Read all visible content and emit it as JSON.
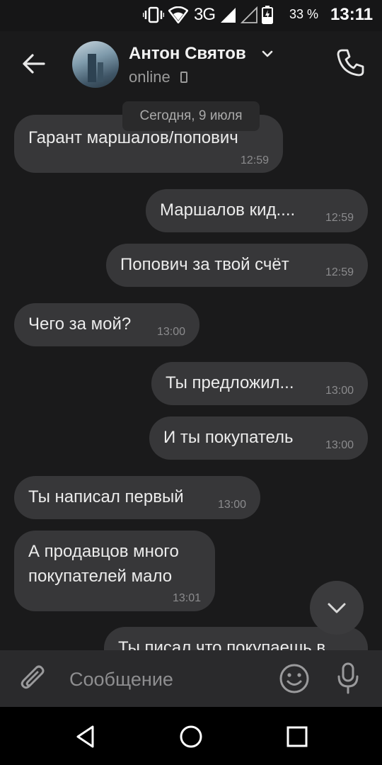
{
  "status_bar": {
    "network": "3G",
    "battery_percent": "33 %",
    "time": "13:11",
    "icons": [
      "vibrate-icon",
      "wifi-icon",
      "signal-icon",
      "signal-empty-icon",
      "battery-charging-icon"
    ]
  },
  "header": {
    "contact_name": "Антон Святов",
    "status": "online",
    "icons": [
      "back-arrow-icon",
      "chevron-down-icon",
      "mobile-device-icon",
      "phone-icon"
    ]
  },
  "chat": {
    "date_separator": "Сегодня, 9 июля",
    "messages": [
      {
        "side": "incoming",
        "lines": [
          "Гарант маршалов/попович"
        ],
        "time": "12:59"
      },
      {
        "side": "outgoing",
        "lines": [
          "Маршалов кид...."
        ],
        "time": "12:59"
      },
      {
        "side": "outgoing",
        "lines": [
          "Попович за твой счёт"
        ],
        "time": "12:59"
      },
      {
        "side": "incoming",
        "lines": [
          "Чего за мой?"
        ],
        "time": "13:00"
      },
      {
        "side": "outgoing",
        "lines": [
          "Ты предложил..."
        ],
        "time": "13:00"
      },
      {
        "side": "outgoing",
        "lines": [
          "И ты покупатель"
        ],
        "time": "13:00"
      },
      {
        "side": "incoming",
        "lines": [
          "Ты написал первый"
        ],
        "time": "13:00"
      },
      {
        "side": "incoming",
        "lines": [
          "А продавцов много",
          "покупателей мало"
        ],
        "time": "13:01"
      },
      {
        "side": "outgoing",
        "lines": [
          "Ты писал что покупаешь в"
        ],
        "time": ""
      }
    ]
  },
  "input_bar": {
    "placeholder": "Сообщение",
    "icons": [
      "attach-paperclip-icon",
      "emoji-icon",
      "microphone-icon"
    ]
  },
  "nav_bar": {
    "icons": [
      "back-triangle-icon",
      "home-circle-icon",
      "recents-square-icon"
    ]
  },
  "colors": {
    "background": "#1a1a1b",
    "bubble": "#373739",
    "input_bar": "#2a2a2c",
    "text": "#ececec",
    "muted": "#8b8b8d"
  }
}
